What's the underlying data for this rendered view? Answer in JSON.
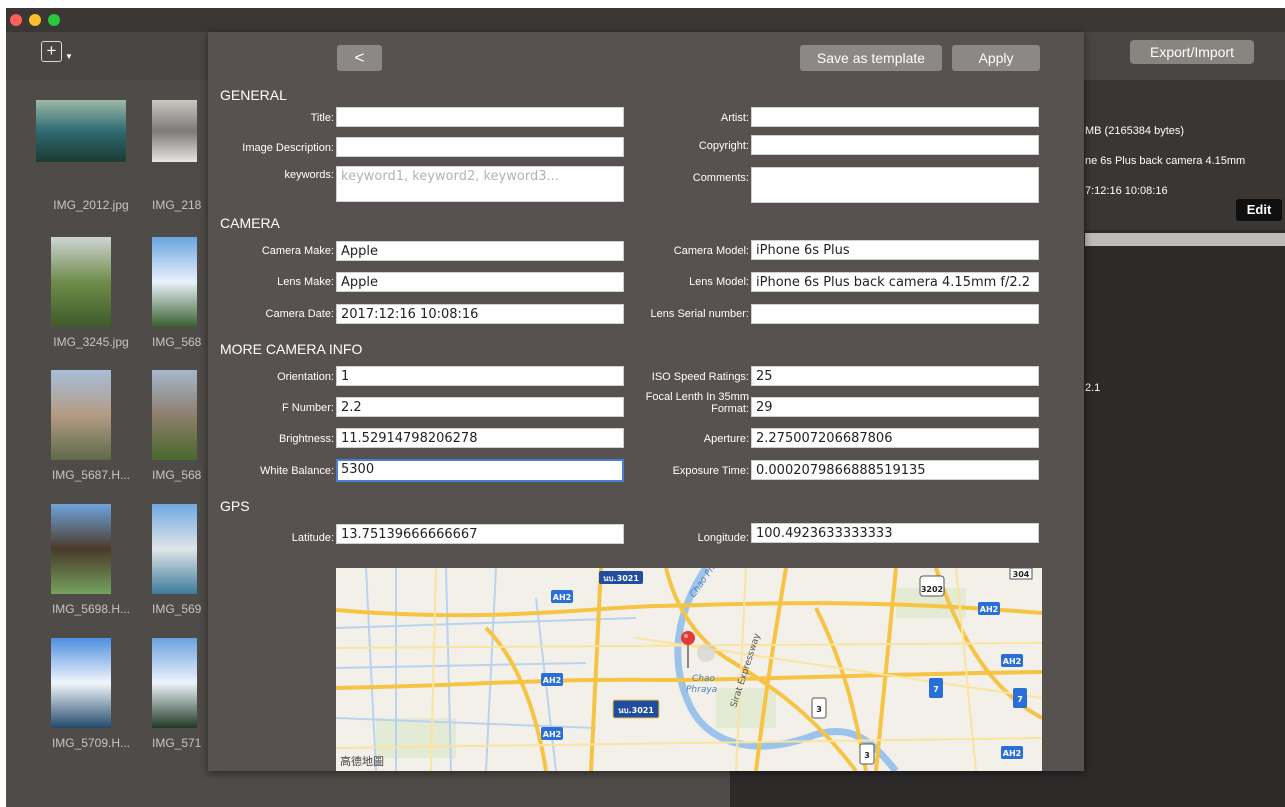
{
  "window": {
    "traffic_lights": [
      {
        "name": "close",
        "color": "#fe5f57"
      },
      {
        "name": "minimize",
        "color": "#febc2e"
      },
      {
        "name": "maximize",
        "color": "#28c840"
      }
    ]
  },
  "toolbar": {
    "add_icon": "plus-icon",
    "add_symbol": "+",
    "add_caret": "▼",
    "export_label": "Export/Import"
  },
  "grid": {
    "items": [
      {
        "filename": "IMG_2012.jpg",
        "scene": "boat"
      },
      {
        "filename": "IMG_218",
        "scene": "stairs"
      },
      {
        "filename": "IMG_3245.jpg",
        "scene": "hillside"
      },
      {
        "filename": "IMG_568",
        "scene": "palms"
      },
      {
        "filename": "IMG_5687.H...",
        "scene": "building"
      },
      {
        "filename": "IMG_568",
        "scene": "building-garden"
      },
      {
        "filename": "IMG_5698.H...",
        "scene": "pavilion"
      },
      {
        "filename": "IMG_569",
        "scene": "beach"
      },
      {
        "filename": "IMG_5709.H...",
        "scene": "sky"
      },
      {
        "filename": "IMG_571",
        "scene": "palm-sky"
      }
    ]
  },
  "info_pane": {
    "size_text": "MB (2165384 bytes)",
    "camera_text": "ne 6s Plus back camera 4.15mm",
    "date_text": "7:12:16 10:08:16",
    "edit_label": "Edit",
    "extra_text": "2.1"
  },
  "panel": {
    "back_symbol": "<",
    "save_template_label": "Save as template",
    "apply_label": "Apply",
    "sections": {
      "general": "GENERAL",
      "camera": "CAMERA",
      "more": "MORE CAMERA INFO",
      "gps": "GPS"
    },
    "fields": {
      "title": {
        "label": "Title:",
        "value": ""
      },
      "artist": {
        "label": "Artist:",
        "value": ""
      },
      "image_description": {
        "label": "Image Description:",
        "value": ""
      },
      "copyright": {
        "label": "Copyright:",
        "value": ""
      },
      "keywords": {
        "label": "keywords:",
        "value": "",
        "placeholder": "keyword1, keyword2, keyword3..."
      },
      "comments": {
        "label": "Comments:",
        "value": ""
      },
      "camera_make": {
        "label": "Camera Make:",
        "value": "Apple"
      },
      "camera_model": {
        "label": "Camera Model:",
        "value": "iPhone 6s Plus"
      },
      "lens_make": {
        "label": "Lens Make:",
        "value": "Apple"
      },
      "lens_model": {
        "label": "Lens Model:",
        "value": "iPhone 6s Plus back camera 4.15mm f/2.2"
      },
      "camera_date": {
        "label": "Camera Date:",
        "value": "2017:12:16 10:08:16"
      },
      "lens_serial": {
        "label": "Lens Serial number:",
        "value": ""
      },
      "orientation": {
        "label": "Orientation:",
        "value": "1"
      },
      "iso": {
        "label": "ISO Speed Ratings:",
        "value": "25"
      },
      "f_number": {
        "label": "F Number:",
        "value": "2.2"
      },
      "focal_35mm": {
        "label": "Focal Lenth In 35mm Format:",
        "value": "29"
      },
      "brightness": {
        "label": "Brightness:",
        "value": "11.52914798206278"
      },
      "aperture": {
        "label": "Aperture:",
        "value": "2.275007206687806"
      },
      "white_balance": {
        "label": "White Balance:",
        "value": "5300"
      },
      "exposure_time": {
        "label": "Exposure Time:",
        "value": "0.0002079866888519135"
      },
      "latitude": {
        "label": "Latitude:",
        "value": "13.75139666666667"
      },
      "longitude": {
        "label": "Longitude:",
        "value": "100.4923633333333"
      }
    },
    "map": {
      "pin_icon": "location-pin-icon",
      "labels": [
        "Chao Phraya",
        "Chao Phraya",
        "Sirat Expressway"
      ],
      "road_badges": [
        "นบ.3021",
        "AH2",
        "AH2",
        "AH2",
        "AH2",
        "AH2",
        "3202",
        "304",
        "นบ.3021",
        "3",
        "3",
        "7",
        "7",
        "AH2"
      ],
      "credit": "高德地圖"
    }
  }
}
